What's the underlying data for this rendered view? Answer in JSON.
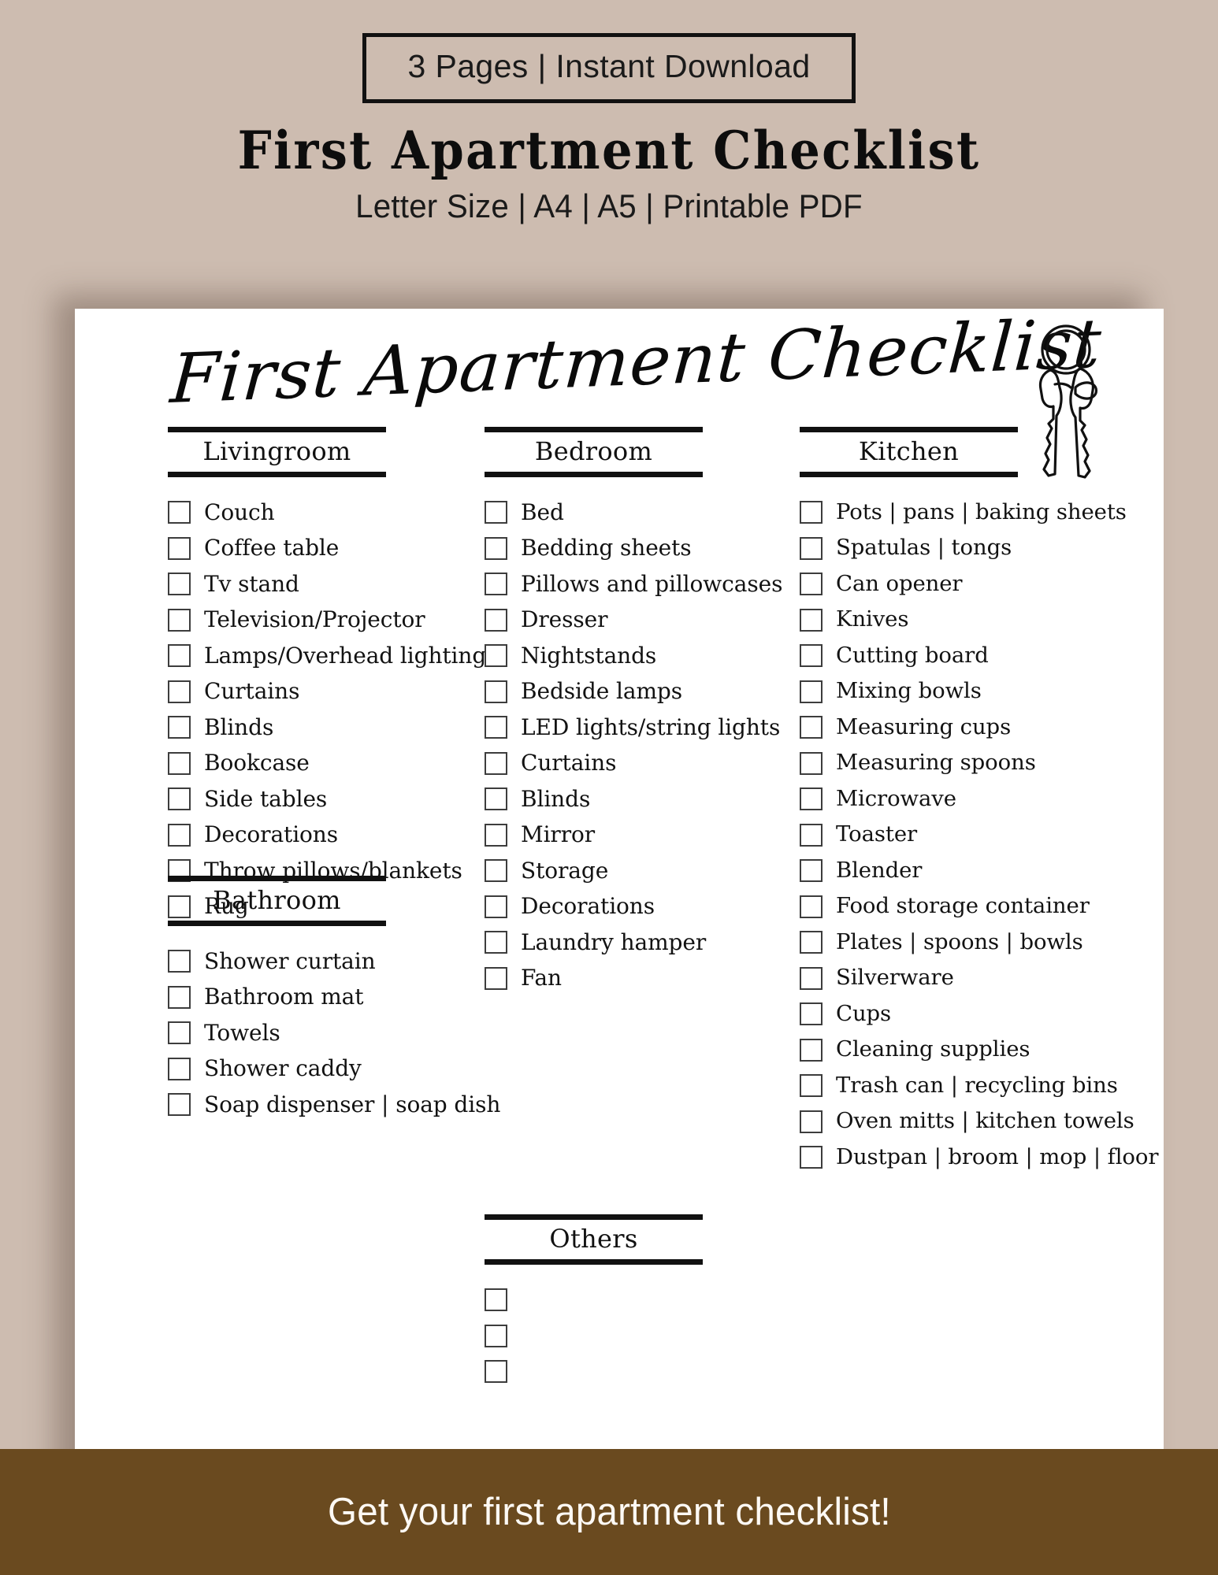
{
  "promo": {
    "badge_label": "3 Pages | Instant Download",
    "title": "First Apartment Checklist",
    "subtitle": "Letter Size | A4 | A5 | Printable PDF"
  },
  "sheet": {
    "script_title": "First Apartment Checklist",
    "keys_icon_name": "keys-icon"
  },
  "columns": [
    {
      "id": "column-left",
      "sections": [
        {
          "id": "section-livingroom",
          "title": "Livingroom",
          "items": [
            "Couch",
            "Coffee table",
            "Tv stand",
            "Television/Projector",
            "Lamps/Overhead lighting",
            "Curtains",
            "Blinds",
            "Bookcase",
            "Side tables",
            "Decorations",
            "Throw pillows/blankets",
            "Rug"
          ]
        },
        {
          "id": "section-bathroom",
          "title": "Bathroom",
          "items": [
            "Shower curtain",
            "Bathroom mat",
            "Towels",
            "Shower caddy",
            "Soap dispenser | soap dish"
          ]
        }
      ]
    },
    {
      "id": "column-middle",
      "sections": [
        {
          "id": "section-bedroom",
          "title": "Bedroom",
          "items": [
            "Bed",
            "Bedding sheets",
            "Pillows and pillowcases",
            "Dresser",
            "Nightstands",
            "Bedside lamps",
            "LED lights/string lights",
            "Curtains",
            "Blinds",
            "Mirror",
            "Storage",
            "Decorations",
            "Laundry hamper",
            "Fan"
          ]
        },
        {
          "id": "section-others",
          "title": "Others",
          "items": [
            "",
            "",
            ""
          ]
        }
      ]
    },
    {
      "id": "column-right",
      "sections": [
        {
          "id": "section-kitchen",
          "title": "Kitchen",
          "items": [
            "Pots | pans | baking sheets",
            "Spatulas | tongs",
            "Can opener",
            "Knives",
            "Cutting board",
            "Mixing bowls",
            "Measuring cups",
            "Measuring spoons",
            "Microwave",
            "Toaster",
            "Blender",
            "Food storage container",
            "Plates | spoons | bowls",
            "Silverware",
            "Cups",
            "Cleaning supplies",
            "Trash can | recycling bins",
            "Oven mitts | kitchen towels",
            "Dustpan | broom | mop | floor cleaner"
          ]
        }
      ]
    }
  ],
  "footer": {
    "cta": "Get your first apartment checklist!"
  },
  "colors": {
    "background": "#cdbcb0",
    "paper": "#ffffff",
    "ink": "#111111",
    "footer_background": "#6a4a1f",
    "footer_text": "#fdf9f4"
  }
}
